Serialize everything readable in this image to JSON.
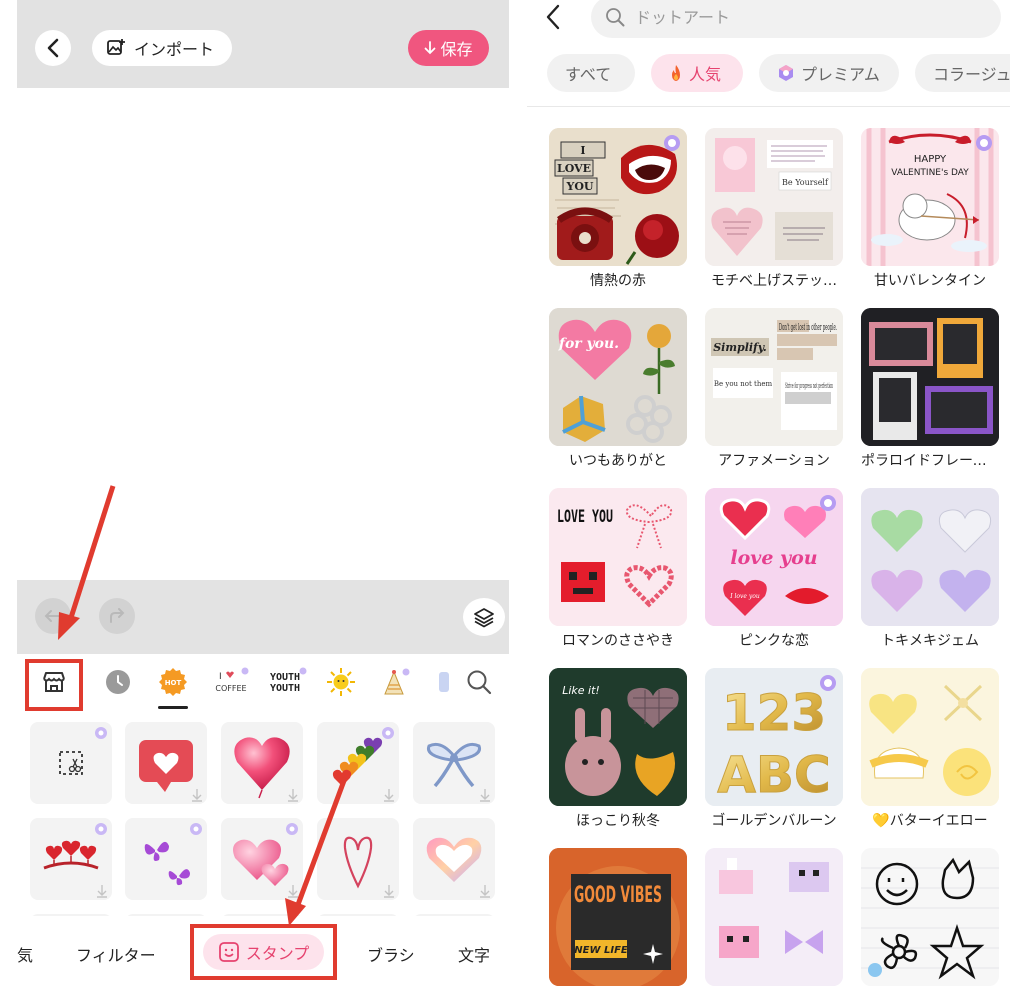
{
  "editor": {
    "header": {
      "import_label": "インポート",
      "save_label": "保存"
    },
    "sticker_categories": [
      {
        "icon": "store-icon"
      },
      {
        "icon": "clock-icon"
      },
      {
        "icon": "hot-badge-icon",
        "label": "HOT"
      },
      {
        "icon": "i-love-coffee-icon",
        "label": "I COFFEE"
      },
      {
        "icon": "youth-text-icon",
        "label": "YOUTH"
      },
      {
        "icon": "sun-icon"
      },
      {
        "icon": "party-hat-icon"
      },
      {
        "icon": "search-icon"
      }
    ],
    "stickers": [
      {
        "name": "cutout-scissors",
        "premium": true
      },
      {
        "name": "heart-speech-bubble",
        "premium": false
      },
      {
        "name": "pink-heart-balloon",
        "premium": false
      },
      {
        "name": "rainbow-hearts-stack",
        "premium": true
      },
      {
        "name": "blue-ribbon-bow",
        "premium": false
      },
      {
        "name": "heart-headband",
        "premium": true
      },
      {
        "name": "purple-butterflies",
        "premium": true
      },
      {
        "name": "pink-3d-hearts",
        "premium": true
      },
      {
        "name": "outline-heart",
        "premium": false
      },
      {
        "name": "gradient-glow-heart",
        "premium": false
      }
    ],
    "bottom_nav": [
      {
        "label": "気"
      },
      {
        "label": "フィルター"
      },
      {
        "label": "スタンプ",
        "active": true
      },
      {
        "label": "ブラシ"
      },
      {
        "label": "文字"
      }
    ]
  },
  "store": {
    "search_placeholder": "ドットアート",
    "chips": [
      {
        "label": "すべて",
        "active": false
      },
      {
        "label": "人気",
        "active": true,
        "icon": "fire-icon"
      },
      {
        "label": "プレミアム",
        "active": false,
        "icon": "premium-gem-icon"
      },
      {
        "label": "コラージュ",
        "active": false
      }
    ],
    "packs": [
      {
        "title": "情熱の赤",
        "premium": true
      },
      {
        "title": "モチベ上げステッ…",
        "premium": false
      },
      {
        "title": "甘いバレンタイン",
        "premium": true
      },
      {
        "title": "いつもありがと",
        "premium": false
      },
      {
        "title": "アファメーション",
        "premium": false
      },
      {
        "title": "ポラロイドフレーム…",
        "premium": false
      },
      {
        "title": "ロマンのささやき",
        "premium": false
      },
      {
        "title": "ピンクな恋",
        "premium": true
      },
      {
        "title": "トキメキジェム",
        "premium": false
      },
      {
        "title": "ほっこり秋冬",
        "premium": false
      },
      {
        "title": "ゴールデンバルーン",
        "premium": true
      },
      {
        "title": "💛バターイエロー",
        "premium": false
      },
      {
        "title": "",
        "premium": false
      },
      {
        "title": "",
        "premium": false
      },
      {
        "title": "",
        "premium": false
      }
    ],
    "thumb_text": {
      "love_you_words": [
        "I",
        "LOVE",
        "YOU"
      ],
      "be_yourself": "Be Yourself",
      "happy_valentines": "HAPPY",
      "valentines_day": "VALENTINE's DAY",
      "for_you": "for you.",
      "simplify": "Simplify.",
      "dont_get_lost": "Don't get lost in other people.",
      "be_you_not_them": "Be you not them",
      "strive_for_progress": "Strive for progress not perfection",
      "love_you_pixel": "LOVE YOU",
      "love_you_script": "love you",
      "i_love_you_small": "I love you",
      "like_it": "Like it!",
      "digits": "123",
      "letters": "ABC",
      "good_vibes": "GOOD VIBES",
      "new_life": "NEW LIFE"
    }
  },
  "colors": {
    "accent": "#f0567f",
    "highlight_box": "#e03b2f",
    "active_chip_bg": "#fde3ec",
    "active_chip_text": "#e6436f"
  }
}
